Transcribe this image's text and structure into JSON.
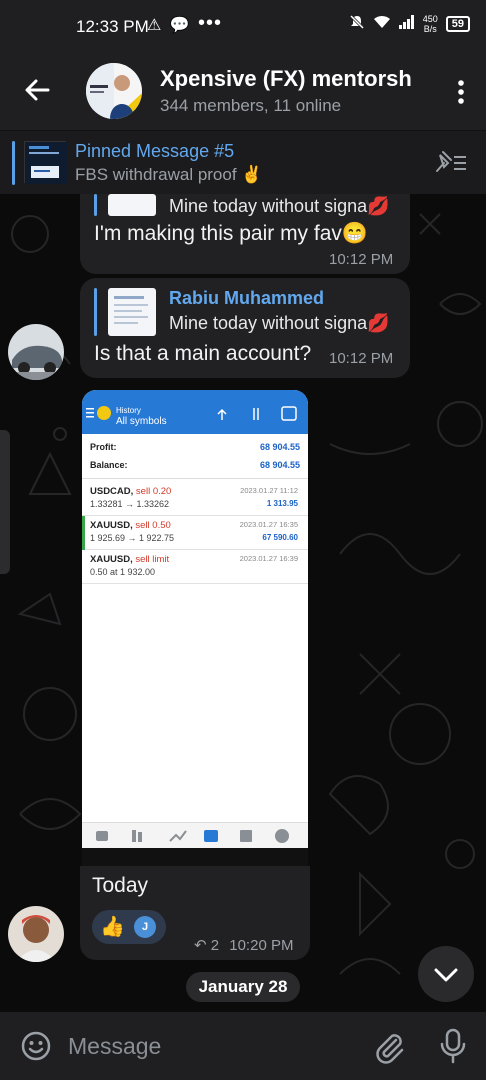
{
  "status_bar": {
    "time": "12:33 PM",
    "left_icons": "⚠ 💬",
    "dots": "•••",
    "speed_value": "450",
    "speed_unit": "B/s",
    "battery": "59"
  },
  "header": {
    "title": "Xpensive (FX) mentorsh",
    "subtitle": "344 members, 11 online"
  },
  "pinned": {
    "title": "Pinned Message #5",
    "subtitle": "FBS withdrawal proof ✌️"
  },
  "messages": [
    {
      "reply_text": "Mine today without signa💋",
      "text": "I'm making this pair my fav😁",
      "time": "10:12 PM"
    },
    {
      "reply_name": "Rabiu Muhammed",
      "reply_text": "Mine today without signa💋",
      "text": "Is that a main account?",
      "time": "10:12 PM"
    }
  ],
  "photo": {
    "app_title_top": "History",
    "app_title": "All symbols",
    "profit_label": "Profit:",
    "profit_value": "68 904.55",
    "balance_label": "Balance:",
    "balance_value": "68 904.55",
    "trades": [
      {
        "symbol": "USDCAD,",
        "action": "sell 0.20",
        "prices": "1.33281 → 1.33262",
        "date": "2023.01.27 11:12",
        "profit": "1 313.95"
      },
      {
        "symbol": "XAUUSD,",
        "action": "sell 0.50",
        "prices": "1 925.69 → 1 922.75",
        "date": "2023.01.27 16:35",
        "profit": "67 590.60"
      },
      {
        "symbol": "XAUUSD,",
        "action": "sell limit",
        "prices": "0.50 at 1 932.00",
        "date": "2023.01.27 16:39",
        "profit": ""
      }
    ]
  },
  "photo_message": {
    "text": "Today",
    "reaction_emoji": "👍",
    "reaction_user": "J",
    "forward_count": "↶ 2",
    "time": "10:20 PM"
  },
  "date_chip": "January 28",
  "input": {
    "placeholder": "Message"
  },
  "colors": {
    "accent": "#62a8ee",
    "bubble": "#212123",
    "bar": "#1f1f21",
    "background": "#0b0b0c"
  }
}
